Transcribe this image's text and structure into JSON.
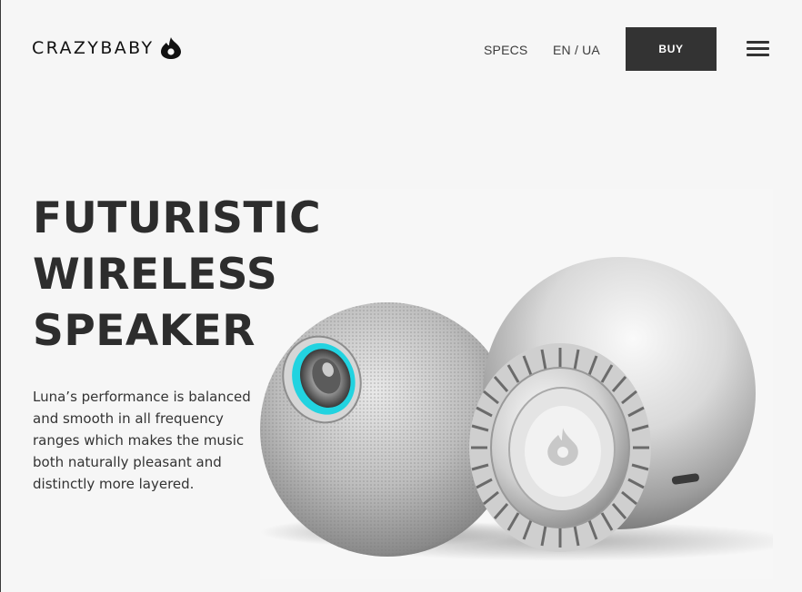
{
  "header": {
    "logo_text": "CRAZYBABY",
    "logo_icon": "drop-eye-icon",
    "nav": {
      "specs_label": "SPECS",
      "language_label": "EN / UA"
    },
    "buy_label": "BUY",
    "menu_icon": "hamburger-menu-icon"
  },
  "hero": {
    "headline_lines": [
      "FUTURISTIC",
      "WIRELESS",
      "SPEAKER"
    ],
    "description": "Luna’s performance is balanced and smooth in all frequency ranges which makes the music both naturally pleasant and distinctly more layered.",
    "image": "two-silver-spherical-speakers"
  },
  "colors": {
    "background": "#f6f6f6",
    "button_bg": "#333333",
    "accent_glow": "#22d3e0",
    "text": "#2d2d2d"
  }
}
